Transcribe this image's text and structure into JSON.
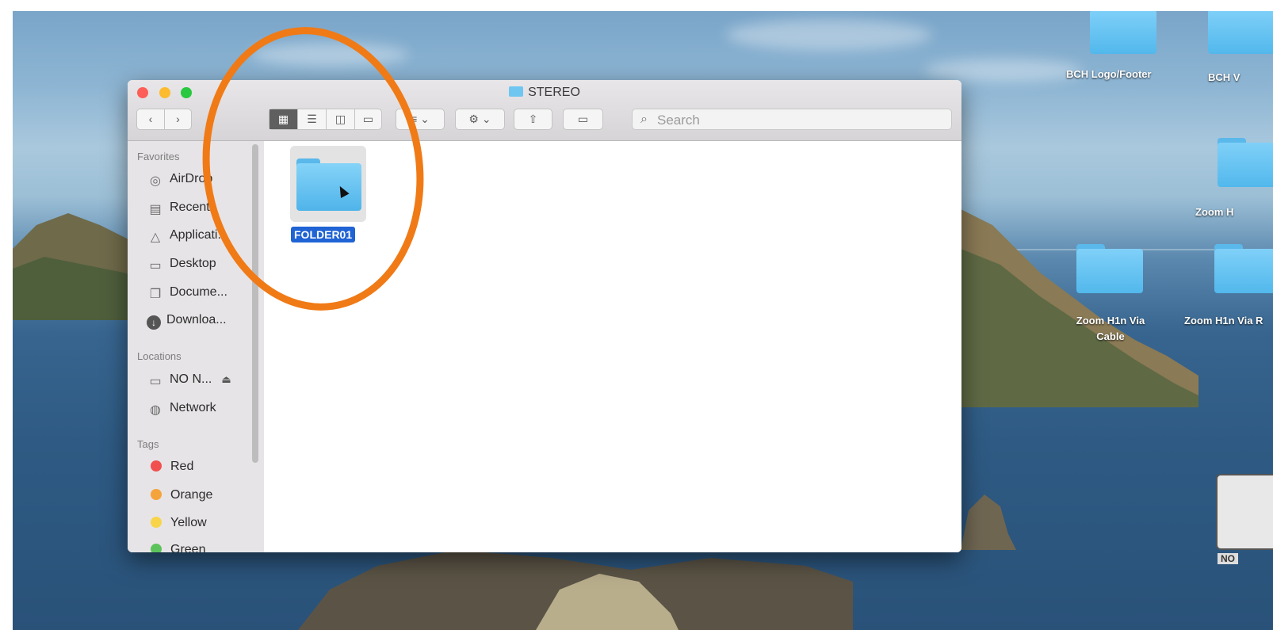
{
  "window": {
    "title": "STEREO",
    "search_placeholder": "Search"
  },
  "sidebar": {
    "favorites_header": "Favorites",
    "favorites": [
      {
        "label": "AirDrop",
        "icon": "airdrop-icon"
      },
      {
        "label": "Recents",
        "icon": "recents-icon"
      },
      {
        "label": "Applicati...",
        "icon": "applications-icon"
      },
      {
        "label": "Desktop",
        "icon": "desktop-icon"
      },
      {
        "label": "Docume...",
        "icon": "documents-icon"
      },
      {
        "label": "Downloa...",
        "icon": "downloads-icon"
      }
    ],
    "locations_header": "Locations",
    "locations": [
      {
        "label": "NO N...",
        "icon": "drive-icon"
      },
      {
        "label": "Network",
        "icon": "network-icon"
      }
    ],
    "tags_header": "Tags",
    "tags": [
      {
        "label": "Red",
        "color": "#f0504e"
      },
      {
        "label": "Orange",
        "color": "#f5a33b"
      },
      {
        "label": "Yellow",
        "color": "#f8d44a"
      },
      {
        "label": "Green",
        "color": "#5bc35a"
      }
    ]
  },
  "content": {
    "items": [
      {
        "label": "FOLDER01",
        "selected": true
      }
    ]
  },
  "desktop": {
    "icons": [
      {
        "label": "BCH Logo/Footer"
      },
      {
        "label": "BCH V"
      },
      {
        "label": "Zoom H"
      },
      {
        "label": "Zoom H1n Via Cable"
      },
      {
        "label": "Zoom H1n Via R"
      },
      {
        "label": "NO"
      }
    ]
  },
  "colors": {
    "annotation": "#f07a16",
    "selection": "#1f63d4",
    "folder": "#5ab8ea"
  }
}
